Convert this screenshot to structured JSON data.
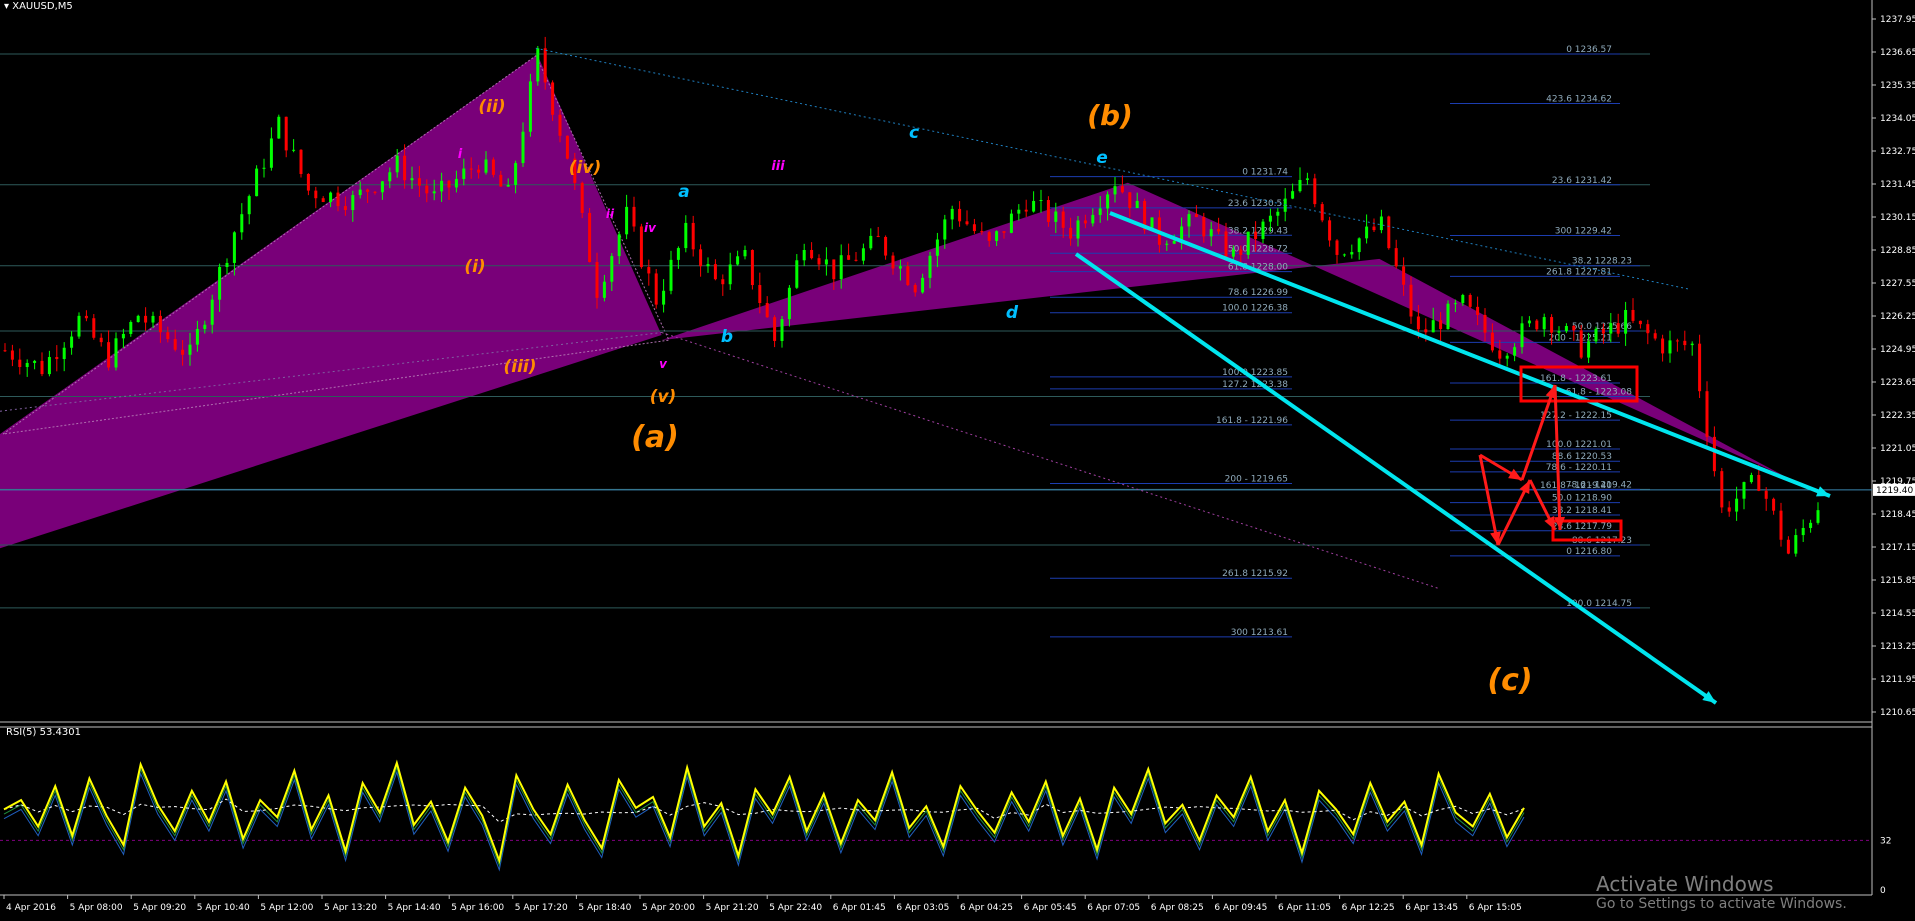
{
  "window": {
    "symbol": "XAUUSD,M5"
  },
  "rsi_header": "RSI(5) 53.4301",
  "watermark": {
    "line1": "Activate Windows",
    "line2": "Go to Settings to activate Windows."
  },
  "colors": {
    "background": "#000000",
    "bull_candle": "#00ff00",
    "bear_candle": "#ff0000",
    "pattern_fill": "#800080",
    "channel_line": "#00e5ee",
    "rsi_line": "#ffff00",
    "fib_text": "#6a7f8f",
    "wave_orange": "#ff8c00",
    "wave_cyan": "#00bfff",
    "wave_magenta": "#ff00ff",
    "highlight_box": "#ff0000",
    "current_price": "#1e90ff"
  },
  "chart_data": {
    "type": "candlestick",
    "symbol": "XAUUSD",
    "timeframe": "M5",
    "ylim": [
      1210.65,
      1237.95
    ],
    "y_ticks": [
      "1237.95",
      "1236.65",
      "1235.35",
      "1234.05",
      "1232.75",
      "1231.45",
      "1230.15",
      "1228.85",
      "1227.55",
      "1226.25",
      "1224.95",
      "1223.65",
      "1222.35",
      "1221.05",
      "1219.75",
      "1218.45",
      "1217.15",
      "1215.85",
      "1214.55",
      "1213.25",
      "1211.95",
      "1210.65"
    ],
    "current_price": "1219.40",
    "x_ticks": [
      "4 Apr 2016",
      "5 Apr 08:00",
      "5 Apr 09:20",
      "5 Apr 10:40",
      "5 Apr 12:00",
      "5 Apr 13:20",
      "5 Apr 14:40",
      "5 Apr 16:00",
      "5 Apr 17:20",
      "5 Apr 18:40",
      "5 Apr 20:00",
      "5 Apr 21:20",
      "5 Apr 22:40",
      "6 Apr 01:45",
      "6 Apr 03:05",
      "6 Apr 04:25",
      "6 Apr 05:45",
      "6 Apr 07:05",
      "6 Apr 08:25",
      "6 Apr 09:45",
      "6 Apr 11:05",
      "6 Apr 12:25",
      "6 Apr 13:45",
      "6 Apr 15:05"
    ],
    "price_path": [
      [
        0,
        1224.9
      ],
      [
        5,
        1224.2
      ],
      [
        10,
        1226.1
      ],
      [
        14,
        1224.6
      ],
      [
        18,
        1226.3
      ],
      [
        25,
        1224.7
      ],
      [
        31,
        1229.6
      ],
      [
        37,
        1233.8
      ],
      [
        41,
        1231.2
      ],
      [
        47,
        1230.8
      ],
      [
        53,
        1232.2
      ],
      [
        58,
        1230.9
      ],
      [
        64,
        1232.3
      ],
      [
        68,
        1231.0
      ],
      [
        72,
        1236.5
      ],
      [
        76,
        1232.6
      ],
      [
        80,
        1227.3
      ],
      [
        84,
        1230.2
      ],
      [
        88,
        1226.9
      ],
      [
        92,
        1229.5
      ],
      [
        96,
        1227.6
      ],
      [
        100,
        1228.5
      ],
      [
        104,
        1225.3
      ],
      [
        108,
        1229.3
      ],
      [
        112,
        1228.0
      ],
      [
        118,
        1229.2
      ],
      [
        123,
        1227.5
      ],
      [
        128,
        1230.5
      ],
      [
        133,
        1229.0
      ],
      [
        138,
        1230.8
      ],
      [
        144,
        1229.6
      ],
      [
        150,
        1231.6
      ],
      [
        156,
        1229.3
      ],
      [
        161,
        1230.0
      ],
      [
        166,
        1228.6
      ],
      [
        172,
        1230.3
      ],
      [
        176,
        1231.7
      ],
      [
        180,
        1228.8
      ],
      [
        186,
        1229.8
      ],
      [
        191,
        1225.5
      ],
      [
        197,
        1226.7
      ],
      [
        202,
        1224.9
      ],
      [
        208,
        1226.3
      ],
      [
        213,
        1225.0
      ],
      [
        219,
        1226.1
      ],
      [
        224,
        1225.1
      ],
      [
        228,
        1225.1
      ],
      [
        232,
        1218.6
      ],
      [
        237,
        1219.8
      ],
      [
        241,
        1216.9
      ],
      [
        246,
        1219.3
      ]
    ],
    "fib_levels": [
      {
        "label": "0 1236.57"
      },
      {
        "label": "423.6 1234.62"
      },
      {
        "label": "23.6 1231.42"
      },
      {
        "label": "0 1231.74"
      },
      {
        "label": "23.6 1230.51"
      },
      {
        "label": "38.2 1229.43"
      },
      {
        "label": "300 1229.42"
      },
      {
        "label": "50.0 1228.72"
      },
      {
        "label": "38.2 1228.23"
      },
      {
        "label": "61.8 1228.00"
      },
      {
        "label": "261.8 1227.81"
      },
      {
        "label": "78.6 1226.99"
      },
      {
        "label": "100.0 1226.38"
      },
      {
        "label": "50.0 1225.66"
      },
      {
        "label": "200 - 1225.21"
      },
      {
        "label": "100.0 1223.85"
      },
      {
        "label": "127.2 1223.38"
      },
      {
        "label": "161.8 - 1223.61"
      },
      {
        "label": "61.8 - 1223.08"
      },
      {
        "label": "127.2 - 1222.15"
      },
      {
        "label": "161.8 - 1221.96"
      },
      {
        "label": "100.0 1221.01"
      },
      {
        "label": "88.6 1220.53"
      },
      {
        "label": "78.6 - 1220.11"
      },
      {
        "label": "200 - 1219.65"
      },
      {
        "label": "161.8 - 1219.40"
      },
      {
        "label": "78.6 - 1219.42"
      },
      {
        "label": "50.0 1218.90"
      },
      {
        "label": "38.2 1218.41"
      },
      {
        "label": "23.6 1217.79"
      },
      {
        "label": "88.6 1217.23"
      },
      {
        "label": "0 1216.80"
      },
      {
        "label": "261.8 1215.92"
      },
      {
        "label": "100.0 1214.75"
      },
      {
        "label": "300 1213.61"
      }
    ],
    "wave_labels": [
      {
        "text": "(b)",
        "color": "orange"
      },
      {
        "text": "(a)",
        "color": "orange"
      },
      {
        "text": "(c)",
        "color": "orange"
      },
      {
        "text": "(ii)",
        "color": "orange"
      },
      {
        "text": "(iv)",
        "color": "orange"
      },
      {
        "text": "(i)",
        "color": "orange"
      },
      {
        "text": "(iii)",
        "color": "orange"
      },
      {
        "text": "(v)",
        "color": "orange"
      },
      {
        "text": "a",
        "color": "cyan"
      },
      {
        "text": "b",
        "color": "cyan"
      },
      {
        "text": "c",
        "color": "cyan"
      },
      {
        "text": "d",
        "color": "cyan"
      },
      {
        "text": "e",
        "color": "cyan"
      },
      {
        "text": "i",
        "color": "magenta"
      },
      {
        "text": "ii",
        "color": "magenta"
      },
      {
        "text": "iii",
        "color": "magenta"
      },
      {
        "text": "iv",
        "color": "magenta"
      },
      {
        "text": "v",
        "color": "magenta"
      }
    ],
    "rsi": {
      "period": 5,
      "value": 53.4301,
      "ylim": [
        0,
        100
      ],
      "level_labels": [
        "32",
        "0"
      ],
      "values": [
        52,
        58,
        41,
        67,
        35,
        72,
        48,
        29,
        81,
        55,
        38,
        64,
        44,
        70,
        33,
        58,
        47,
        77,
        39,
        61,
        25,
        69,
        50,
        82,
        42,
        57,
        31,
        66,
        48,
        19,
        74,
        52,
        36,
        68,
        45,
        27,
        71,
        53,
        60,
        34,
        79,
        41,
        56,
        22,
        65,
        49,
        73,
        38,
        62,
        30,
        58,
        45,
        76,
        40,
        54,
        28,
        67,
        51,
        37,
        63,
        44,
        70,
        35,
        59,
        26,
        66,
        49,
        78,
        43,
        55,
        32,
        61,
        47,
        73,
        38,
        58,
        24,
        64,
        52,
        36,
        69,
        44,
        57,
        29,
        75,
        50,
        41,
        62,
        34,
        53
      ]
    }
  }
}
